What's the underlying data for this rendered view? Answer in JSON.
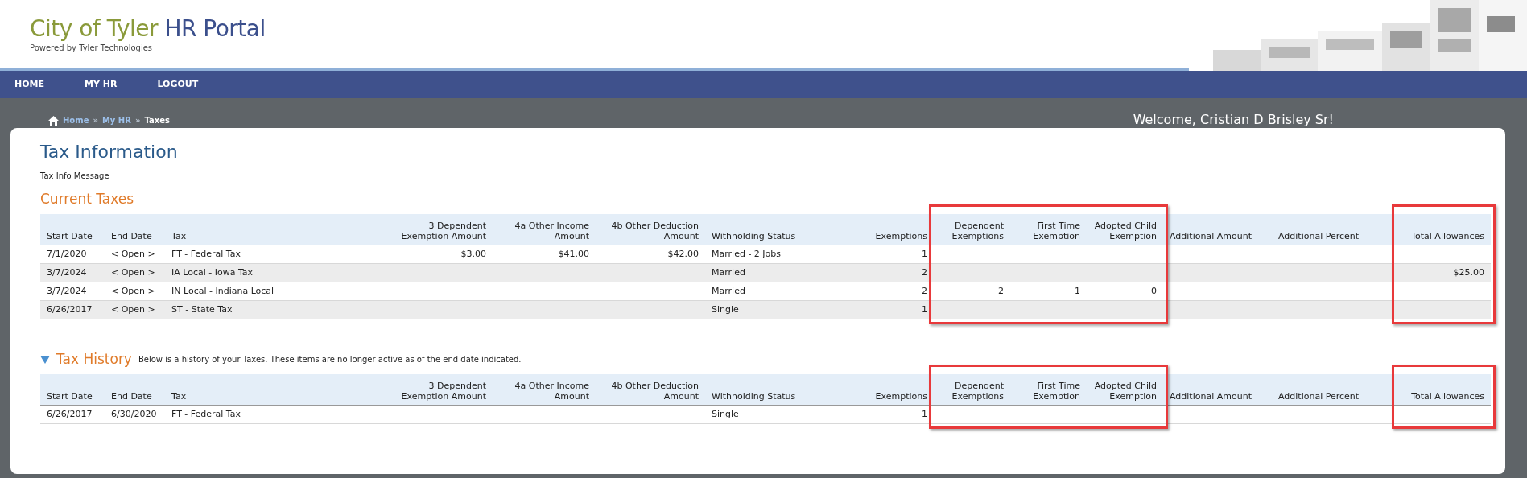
{
  "header": {
    "title_city": "City of Tyler",
    "title_portal": "HR Portal",
    "subtitle": "Powered by Tyler Technologies"
  },
  "nav": [
    {
      "label": "HOME"
    },
    {
      "label": "MY HR"
    },
    {
      "label": "LOGOUT"
    }
  ],
  "breadcrumb": [
    {
      "kind": "link",
      "text": "Home"
    },
    {
      "kind": "separator",
      "text": "»"
    },
    {
      "kind": "link",
      "text": "My HR"
    },
    {
      "kind": "separator",
      "text": "»"
    },
    {
      "kind": "current",
      "text": "Taxes"
    }
  ],
  "welcome": "Welcome, Cristian D Brisley Sr!",
  "page_title": "Tax Information",
  "message": "Tax Info Message",
  "current_taxes": {
    "title": "Current Taxes",
    "columns": [
      {
        "label": "Start Date",
        "highlighted": false
      },
      {
        "label": "End Date",
        "highlighted": false
      },
      {
        "label": "Tax",
        "highlighted": false
      },
      {
        "label": "3 Dependent Exemption Amount",
        "highlighted": false
      },
      {
        "label": "4a Other Income Amount",
        "highlighted": false
      },
      {
        "label": "4b Other Deduction Amount",
        "highlighted": false
      },
      {
        "label": "Withholding Status",
        "highlighted": false
      },
      {
        "label": "Exemptions",
        "highlighted": false
      },
      {
        "label": "Dependent Exemptions",
        "highlighted": true
      },
      {
        "label": "First Time Exemption",
        "highlighted": true
      },
      {
        "label": "Adopted Child Exemption",
        "highlighted": true
      },
      {
        "label": "Additional Amount",
        "highlighted": false
      },
      {
        "label": "Additional Percent",
        "highlighted": false
      },
      {
        "label": "Total Allowances",
        "highlighted": true
      }
    ],
    "rows": [
      [
        "7/1/2020",
        "< Open >",
        "FT - Federal Tax",
        "$3.00",
        "$41.00",
        "$42.00",
        "Married - 2 Jobs",
        "1",
        "",
        "",
        "",
        "",
        "",
        ""
      ],
      [
        "3/7/2024",
        "< Open >",
        "IA Local - Iowa Tax",
        "",
        "",
        "",
        "Married",
        "2",
        "",
        "",
        "",
        "",
        "",
        "$25.00"
      ],
      [
        "3/7/2024",
        "< Open >",
        "IN Local - Indiana Local",
        "",
        "",
        "",
        "Married",
        "2",
        "2",
        "1",
        "0",
        "",
        "",
        ""
      ],
      [
        "6/26/2017",
        "< Open >",
        "ST - State Tax",
        "",
        "",
        "",
        "Single",
        "1",
        "",
        "",
        "",
        "",
        "",
        ""
      ]
    ]
  },
  "tax_history": {
    "title": "Tax History",
    "expanded": true,
    "note": "Below is a history of your Taxes. These items are no longer active as of the end date indicated.",
    "columns": [
      {
        "label": "Start Date",
        "highlighted": false
      },
      {
        "label": "End Date",
        "highlighted": false
      },
      {
        "label": "Tax",
        "highlighted": false
      },
      {
        "label": "3 Dependent Exemption Amount",
        "highlighted": false
      },
      {
        "label": "4a Other Income Amount",
        "highlighted": false
      },
      {
        "label": "4b Other Deduction Amount",
        "highlighted": false
      },
      {
        "label": "Withholding Status",
        "highlighted": false
      },
      {
        "label": "Exemptions",
        "highlighted": false
      },
      {
        "label": "Dependent Exemptions",
        "highlighted": true
      },
      {
        "label": "First Time Exemption",
        "highlighted": true
      },
      {
        "label": "Adopted Child Exemption",
        "highlighted": true
      },
      {
        "label": "Additional Amount",
        "highlighted": false
      },
      {
        "label": "Additional Percent",
        "highlighted": false
      },
      {
        "label": "Total Allowances",
        "highlighted": true
      }
    ],
    "rows": [
      [
        "6/26/2017",
        "6/30/2020",
        "FT - Federal Tax",
        "",
        "",
        "",
        "Single",
        "1",
        "",
        "",
        "",
        "",
        "",
        ""
      ]
    ]
  }
}
